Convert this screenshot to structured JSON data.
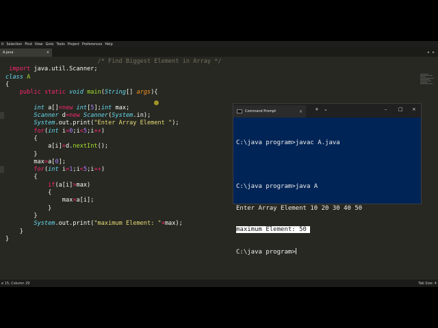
{
  "menu": [
    "it",
    "Selection",
    "Find",
    "View",
    "Goto",
    "Tools",
    "Project",
    "Preferences",
    "Help"
  ],
  "tab": {
    "label": "A.java",
    "close": "×"
  },
  "code_lines": [
    [
      {
        "c": "cm",
        "t": "                          /* Find Biggest Element in Array */"
      }
    ],
    [
      {
        "c": "kw",
        "t": " import"
      },
      {
        "c": "plain",
        "t": " java.util.Scanner;"
      }
    ],
    [
      {
        "c": "ty",
        "t": "class"
      },
      {
        "c": "plain",
        "t": " "
      },
      {
        "c": "fn",
        "t": "A"
      }
    ],
    [
      {
        "c": "plain",
        "t": "{"
      }
    ],
    [
      {
        "c": "plain",
        "t": "    "
      },
      {
        "c": "kw",
        "t": "public"
      },
      {
        "c": "plain",
        "t": " "
      },
      {
        "c": "kw",
        "t": "static"
      },
      {
        "c": "plain",
        "t": " "
      },
      {
        "c": "ty",
        "t": "void"
      },
      {
        "c": "plain",
        "t": " "
      },
      {
        "c": "fn",
        "t": "main"
      },
      {
        "c": "plain",
        "t": "("
      },
      {
        "c": "ty",
        "t": "String"
      },
      {
        "c": "plain",
        "t": "[] "
      },
      {
        "c": "ar",
        "t": "args"
      },
      {
        "c": "plain",
        "t": "){"
      }
    ],
    [
      {
        "c": "plain",
        "t": ""
      }
    ],
    [
      {
        "c": "plain",
        "t": "        "
      },
      {
        "c": "ty",
        "t": "int"
      },
      {
        "c": "plain",
        "t": " a[]"
      },
      {
        "c": "kw",
        "t": "="
      },
      {
        "c": "kw",
        "t": "new"
      },
      {
        "c": "plain",
        "t": " "
      },
      {
        "c": "ty",
        "t": "int"
      },
      {
        "c": "plain",
        "t": "["
      },
      {
        "c": "nm",
        "t": "5"
      },
      {
        "c": "plain",
        "t": "];"
      },
      {
        "c": "ty",
        "t": "int"
      },
      {
        "c": "plain",
        "t": " max;"
      }
    ],
    [
      {
        "c": "plain",
        "t": "        "
      },
      {
        "c": "ty",
        "t": "Scanner"
      },
      {
        "c": "plain",
        "t": " d"
      },
      {
        "c": "kw",
        "t": "="
      },
      {
        "c": "kw",
        "t": "new"
      },
      {
        "c": "plain",
        "t": " "
      },
      {
        "c": "ty",
        "t": "Scanner"
      },
      {
        "c": "plain",
        "t": "("
      },
      {
        "c": "ty",
        "t": "System"
      },
      {
        "c": "plain",
        "t": ".in);"
      }
    ],
    [
      {
        "c": "plain",
        "t": "        "
      },
      {
        "c": "ty",
        "t": "System"
      },
      {
        "c": "plain",
        "t": ".out.print("
      },
      {
        "c": "st",
        "t": "\"Enter Array Element \""
      },
      {
        "c": "plain",
        "t": ");"
      }
    ],
    [
      {
        "c": "plain",
        "t": "        "
      },
      {
        "c": "kw",
        "t": "for"
      },
      {
        "c": "plain",
        "t": "("
      },
      {
        "c": "ty",
        "t": "int"
      },
      {
        "c": "plain",
        "t": " i"
      },
      {
        "c": "kw",
        "t": "="
      },
      {
        "c": "nm",
        "t": "0"
      },
      {
        "c": "plain",
        "t": ";i"
      },
      {
        "c": "kw",
        "t": "<"
      },
      {
        "c": "nm",
        "t": "5"
      },
      {
        "c": "plain",
        "t": ";i"
      },
      {
        "c": "kw",
        "t": "++"
      },
      {
        "c": "plain",
        "t": ")"
      }
    ],
    [
      {
        "c": "plain",
        "t": "        {"
      }
    ],
    [
      {
        "c": "plain",
        "t": "            a[i]"
      },
      {
        "c": "kw",
        "t": "="
      },
      {
        "c": "plain",
        "t": "d."
      },
      {
        "c": "fn",
        "t": "nextInt"
      },
      {
        "c": "plain",
        "t": "();"
      }
    ],
    [
      {
        "c": "plain",
        "t": "        }"
      }
    ],
    [
      {
        "c": "plain",
        "t": "        max"
      },
      {
        "c": "kw",
        "t": "="
      },
      {
        "c": "plain",
        "t": "a["
      },
      {
        "c": "nm",
        "t": "0"
      },
      {
        "c": "plain",
        "t": "];"
      }
    ],
    [
      {
        "c": "plain",
        "t": "        "
      },
      {
        "c": "kw",
        "t": "for"
      },
      {
        "c": "plain",
        "t": "("
      },
      {
        "c": "ty",
        "t": "int"
      },
      {
        "c": "plain",
        "t": " i"
      },
      {
        "c": "kw",
        "t": "="
      },
      {
        "c": "nm",
        "t": "1"
      },
      {
        "c": "plain",
        "t": ";i"
      },
      {
        "c": "kw",
        "t": "<"
      },
      {
        "c": "nm",
        "t": "5"
      },
      {
        "c": "plain",
        "t": ";i"
      },
      {
        "c": "kw",
        "t": "++"
      },
      {
        "c": "plain",
        "t": ")"
      }
    ],
    [
      {
        "c": "plain",
        "t": "        {"
      }
    ],
    [
      {
        "c": "plain",
        "t": "            "
      },
      {
        "c": "kw",
        "t": "if"
      },
      {
        "c": "plain",
        "t": "(a[i]"
      },
      {
        "c": "kw",
        "t": ">"
      },
      {
        "c": "plain",
        "t": "max)"
      }
    ],
    [
      {
        "c": "plain",
        "t": "            {"
      }
    ],
    [
      {
        "c": "plain",
        "t": "                max"
      },
      {
        "c": "kw",
        "t": "="
      },
      {
        "c": "plain",
        "t": "a[i];"
      }
    ],
    [
      {
        "c": "plain",
        "t": "            }"
      }
    ],
    [
      {
        "c": "plain",
        "t": "        }"
      }
    ],
    [
      {
        "c": "plain",
        "t": "        "
      },
      {
        "c": "ty",
        "t": "System"
      },
      {
        "c": "plain",
        "t": ".out.print("
      },
      {
        "c": "st",
        "t": "\"maximum Element: \""
      },
      {
        "c": "kw",
        "t": "+"
      },
      {
        "c": "plain",
        "t": "max);"
      }
    ],
    [
      {
        "c": "plain",
        "t": "    }"
      }
    ],
    [
      {
        "c": "plain",
        "t": "}"
      }
    ]
  ],
  "status": {
    "left": "e 15, Column 29",
    "right": "Tab Size: 4"
  },
  "cmd": {
    "title": "Command Prompt",
    "tab_close": "×",
    "new_tab": "+",
    "dropdown": "⌄",
    "minimize": "–",
    "maximize": "□",
    "close": "×",
    "lines": [
      "",
      "C:\\java program>javac A.java",
      "",
      "C:\\java program>java A",
      "Enter Array Element 10 20 30 40 50"
    ],
    "selected_line": "maximum Element: 50 ",
    "prompt": "C:\\java program>"
  },
  "colors": {
    "editor_bg": "#272822",
    "cmd_bg": "#012456",
    "keyword": "#f92672",
    "type": "#66d9ef",
    "function": "#a6e22e",
    "string": "#e6db74",
    "number": "#ae81ff",
    "comment": "#75715e"
  }
}
